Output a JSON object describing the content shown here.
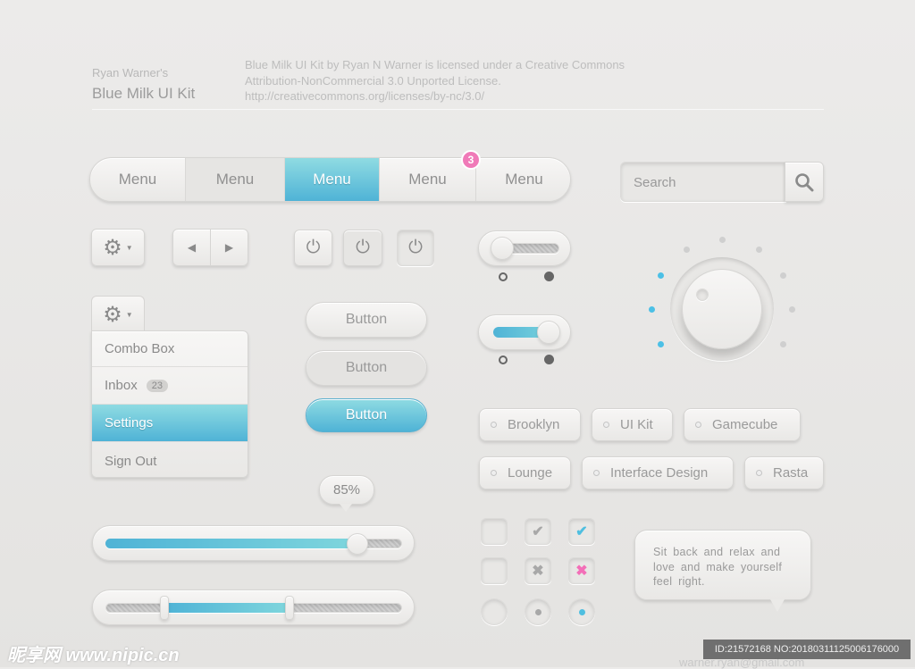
{
  "header": {
    "author": "Ryan Warner's",
    "title": "Blue Milk UI Kit",
    "license": [
      "Blue Milk UI Kit by Ryan N Warner is licensed under a Creative Commons",
      "Attribution-NonCommercial 3.0 Unported License.",
      "http://creativecommons.org/licenses/by-nc/3.0/"
    ]
  },
  "menu": {
    "items": [
      "Menu",
      "Menu",
      "Menu",
      "Menu",
      "Menu"
    ],
    "active_index": 2,
    "badge": "3"
  },
  "search": {
    "placeholder": "Search",
    "icon": "search-icon"
  },
  "dropdown": {
    "items": [
      "Combo Box",
      "Inbox",
      "Settings",
      "Sign Out"
    ],
    "inbox_badge": "23",
    "active": "Settings"
  },
  "buttons": [
    "Button",
    "Button",
    "Button"
  ],
  "toggles": [
    {
      "state": "off"
    },
    {
      "state": "on"
    }
  ],
  "knob": {
    "active_steps": 3,
    "total_steps": 9
  },
  "tags": [
    "Brooklyn",
    "UI Kit",
    "Gamecube",
    "Lounge",
    "Interface Design",
    "Rasta"
  ],
  "slider": {
    "value_label": "85%",
    "value": 85
  },
  "range": {
    "low": 20,
    "high": 62
  },
  "tooltip": "Sit back and relax and love and make yourself feel right.",
  "footer": {
    "watermark": "昵享网 www.nipic.cn",
    "id": "ID:21572168 NO:20180311125006176000",
    "email": "warner.ryan@gmail.com"
  },
  "colors": {
    "accent": "#4fb3d6",
    "badge": "#f07ab8",
    "x_mark": "#f36fb8"
  }
}
